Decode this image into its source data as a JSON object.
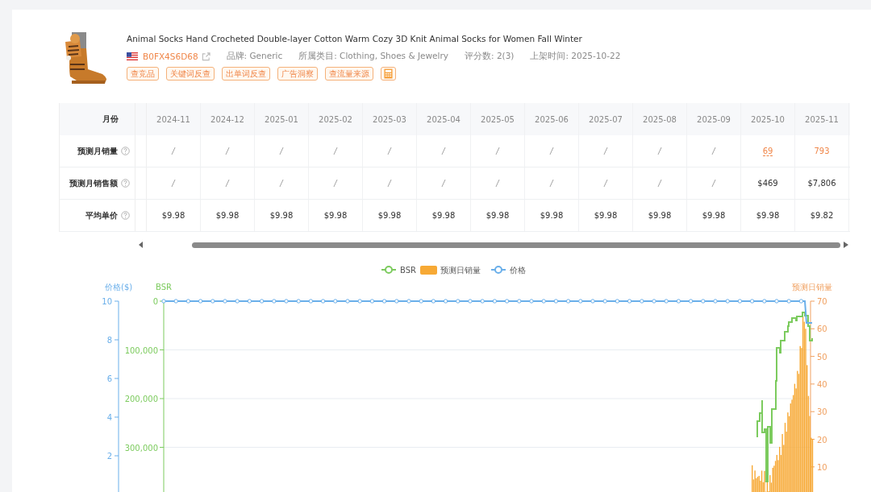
{
  "product": {
    "title": "Animal Socks Hand Crocheted Double-layer Cotton Warm Cozy 3D Knit Animal Socks for Women Fall Winter",
    "asin": "B0FX4S6D68",
    "meta": [
      "品牌: Generic",
      "所属类目: Clothing, Shoes & Jewelry",
      "评分数: 2(3)",
      "上架时间: 2025-10-22"
    ],
    "tags": [
      "查竞品",
      "关键词反查",
      "出单词反查",
      "广告洞察",
      "查流量来源"
    ]
  },
  "table": {
    "header_label": "月份",
    "months": [
      "2024-11",
      "2024-12",
      "2025-01",
      "2025-02",
      "2025-03",
      "2025-04",
      "2025-05",
      "2025-06",
      "2025-07",
      "2025-08",
      "2025-09",
      "2025-10",
      "2025-11"
    ],
    "rows": [
      {
        "label": "预测月销量",
        "cells": [
          {
            "text": "/",
            "kind": "empty"
          },
          {
            "text": "/",
            "kind": "empty"
          },
          {
            "text": "/",
            "kind": "empty"
          },
          {
            "text": "/",
            "kind": "empty"
          },
          {
            "text": "/",
            "kind": "empty"
          },
          {
            "text": "/",
            "kind": "empty"
          },
          {
            "text": "/",
            "kind": "empty"
          },
          {
            "text": "/",
            "kind": "empty"
          },
          {
            "text": "/",
            "kind": "empty"
          },
          {
            "text": "/",
            "kind": "empty"
          },
          {
            "text": "/",
            "kind": "empty"
          },
          {
            "text": "69",
            "kind": "link"
          },
          {
            "text": "793",
            "kind": "highlight"
          }
        ]
      },
      {
        "label": "预测月销售额",
        "cells": [
          {
            "text": "/",
            "kind": "empty"
          },
          {
            "text": "/",
            "kind": "empty"
          },
          {
            "text": "/",
            "kind": "empty"
          },
          {
            "text": "/",
            "kind": "empty"
          },
          {
            "text": "/",
            "kind": "empty"
          },
          {
            "text": "/",
            "kind": "empty"
          },
          {
            "text": "/",
            "kind": "empty"
          },
          {
            "text": "/",
            "kind": "empty"
          },
          {
            "text": "/",
            "kind": "empty"
          },
          {
            "text": "/",
            "kind": "empty"
          },
          {
            "text": "/",
            "kind": "empty"
          },
          {
            "text": "$469",
            "kind": "value"
          },
          {
            "text": "$7,806",
            "kind": "value"
          }
        ]
      },
      {
        "label": "平均单价",
        "cells": [
          {
            "text": "$9.98",
            "kind": "value"
          },
          {
            "text": "$9.98",
            "kind": "value"
          },
          {
            "text": "$9.98",
            "kind": "value"
          },
          {
            "text": "$9.98",
            "kind": "value"
          },
          {
            "text": "$9.98",
            "kind": "value"
          },
          {
            "text": "$9.98",
            "kind": "value"
          },
          {
            "text": "$9.98",
            "kind": "value"
          },
          {
            "text": "$9.98",
            "kind": "value"
          },
          {
            "text": "$9.98",
            "kind": "value"
          },
          {
            "text": "$9.98",
            "kind": "value"
          },
          {
            "text": "$9.98",
            "kind": "value"
          },
          {
            "text": "$9.98",
            "kind": "value"
          },
          {
            "text": "$9.82",
            "kind": "value"
          }
        ]
      }
    ]
  },
  "chart": {
    "legend": [
      {
        "label": "BSR",
        "kind": "line",
        "color": "#7ccb5e"
      },
      {
        "label": "预测日销量",
        "kind": "bar",
        "color": "#f7a935"
      },
      {
        "label": "价格",
        "kind": "line",
        "color": "#6aafea"
      }
    ],
    "price_axis": {
      "title": "价格($)",
      "ticks": [
        "10",
        "8",
        "6",
        "4",
        "2"
      ]
    },
    "bsr_axis": {
      "title": "BSR",
      "ticks": [
        "0",
        "100,000",
        "200,000",
        "300,000"
      ]
    },
    "sales_axis": {
      "title": "预测日销量",
      "ticks": [
        "70",
        "60",
        "50",
        "40",
        "30",
        "20",
        "10"
      ]
    }
  }
}
